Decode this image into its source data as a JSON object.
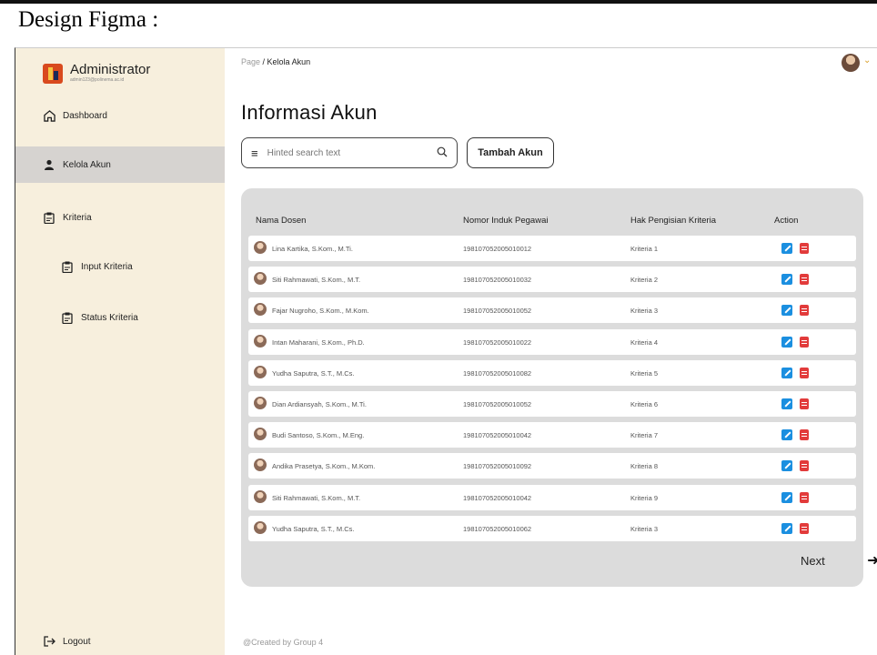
{
  "caption": "Design Figma :",
  "brand": {
    "title": "Administrator",
    "subtitle": "admin123@polinema.ac.id"
  },
  "sidebar": {
    "items": [
      {
        "label": "Dashboard",
        "icon": "home-icon"
      },
      {
        "label": "Kelola Akun",
        "icon": "user-icon",
        "active": true
      },
      {
        "label": "Kriteria",
        "icon": "clipboard-icon"
      },
      {
        "label": "Input Kriteria",
        "icon": "clipboard-icon"
      },
      {
        "label": "Status Kriteria",
        "icon": "clipboard-icon"
      }
    ],
    "logout": "Logout"
  },
  "breadcrumb": {
    "root": "Page",
    "separator": " / ",
    "current": "Kelola Akun"
  },
  "page_title": "Informasi Akun",
  "search": {
    "placeholder": "Hinted search text"
  },
  "add_button": "Tambah Akun",
  "table": {
    "headers": [
      "Nama Dosen",
      "Nomor Induk Pegawai",
      "Hak Pengisian Kriteria",
      "Action"
    ],
    "rows": [
      {
        "name": "Lina Kartika, S.Kom., M.Ti.",
        "nip": "198107052005010012",
        "kriteria": "Kriteria 1"
      },
      {
        "name": "Siti Rahmawati, S.Kom., M.T.",
        "nip": "198107052005010032",
        "kriteria": "Kriteria 2"
      },
      {
        "name": "Fajar Nugroho, S.Kom., M.Kom.",
        "nip": "198107052005010052",
        "kriteria": "Kriteria 3"
      },
      {
        "name": "Intan Maharani, S.Kom., Ph.D.",
        "nip": "198107052005010022",
        "kriteria": "Kriteria 4"
      },
      {
        "name": "Yudha Saputra, S.T., M.Cs.",
        "nip": "198107052005010082",
        "kriteria": "Kriteria 5"
      },
      {
        "name": "Dian Ardiansyah, S.Kom., M.Ti.",
        "nip": "198107052005010052",
        "kriteria": "Kriteria 6"
      },
      {
        "name": "Budi Santoso, S.Kom., M.Eng.",
        "nip": "198107052005010042",
        "kriteria": "Kriteria 7"
      },
      {
        "name": "Andika Prasetya, S.Kom., M.Kom.",
        "nip": "198107052005010092",
        "kriteria": "Kriteria 8"
      },
      {
        "name": "Siti Rahmawati, S.Kom., M.T.",
        "nip": "198107052005010042",
        "kriteria": "Kriteria 9"
      },
      {
        "name": "Yudha Saputra, S.T., M.Cs.",
        "nip": "198107052005010062",
        "kriteria": "Kriteria 3"
      }
    ]
  },
  "pagination": {
    "next": "Next"
  },
  "footer": "@Created by Group 4",
  "colors": {
    "sidebar_bg": "#f7efdd",
    "active_item": "#d6d3d0",
    "panel_bg": "#dcdcdc",
    "edit": "#1b8fe0",
    "delete": "#e23b3b"
  }
}
